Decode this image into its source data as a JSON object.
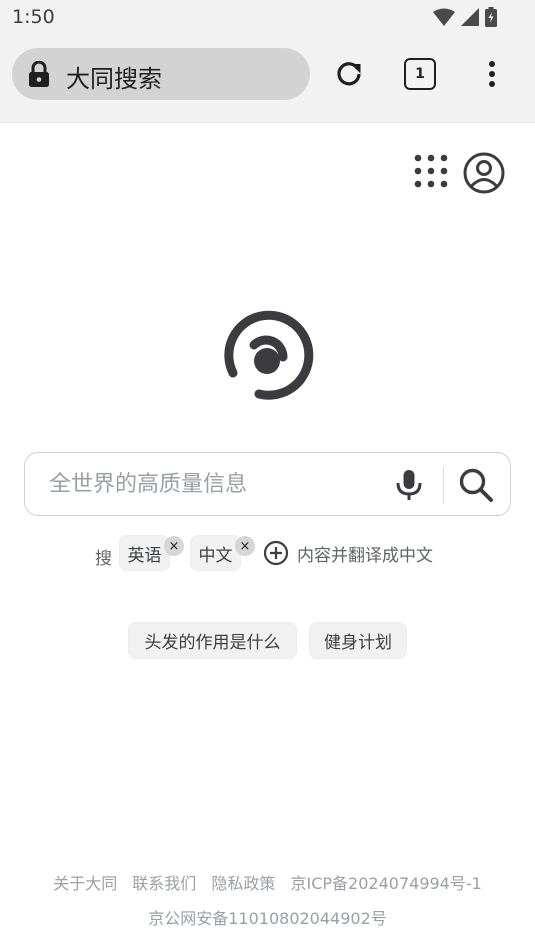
{
  "status_bar": {
    "time": "1:50"
  },
  "browser": {
    "url": "大同搜索",
    "tab_count": "1"
  },
  "search": {
    "placeholder": "全世界的高质量信息"
  },
  "languages": {
    "label": "搜",
    "chips": [
      "英语",
      "中文"
    ],
    "remove_glyph": "×",
    "add_label": "内容并翻译成中文"
  },
  "suggestions": [
    "头发的作用是什么",
    "健身计划"
  ],
  "footer": {
    "links": [
      "关于大同",
      "联系我们",
      "隐私政策",
      "京ICP备2024074994号-1"
    ],
    "record": "京公网安备11010802044902号"
  },
  "colors": {
    "logo": "#3c3c40",
    "text_muted": "#9aa0a6",
    "chip_bg": "#f1f1f1"
  }
}
